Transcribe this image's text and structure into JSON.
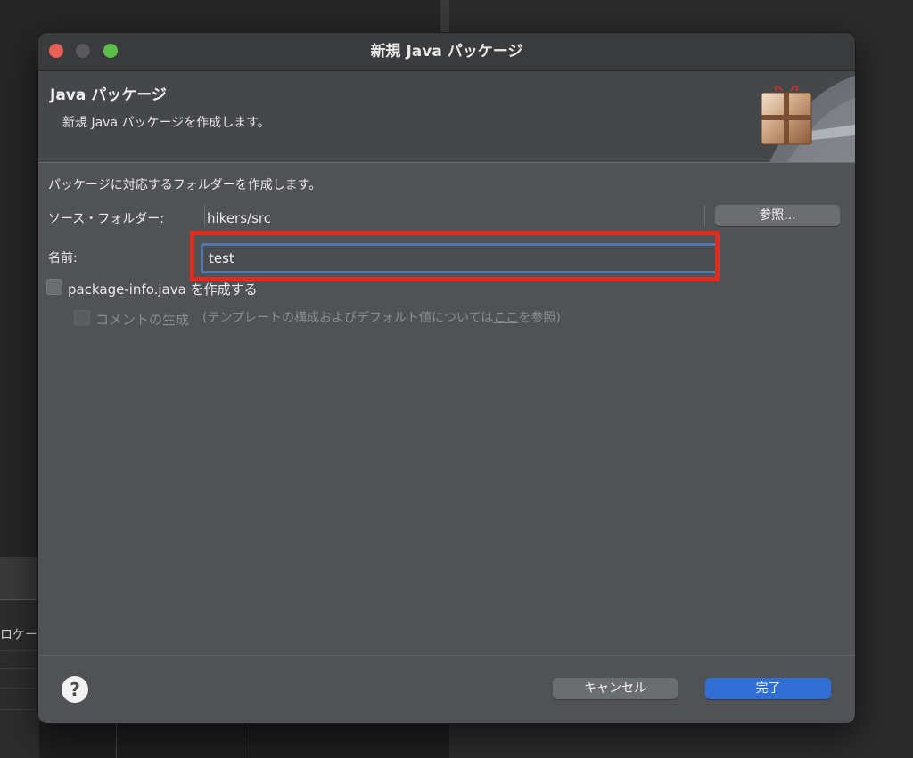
{
  "dialog": {
    "title": "新規 Java パッケージ",
    "header_title": "Java パッケージ",
    "header_description": "新規 Java パッケージを作成します。"
  },
  "form": {
    "info": "パッケージに対応するフォルダーを作成します。",
    "source_folder_label": "ソース・フォルダー:",
    "source_folder_value": "hikers/src",
    "browse_label": "参照...",
    "name_label": "名前:",
    "name_value": "test",
    "package_info_label": "package-info.java を作成する",
    "comment_label": "コメントの生成",
    "template_note_prefix": "(テンプレートの構成およびデフォルト値については",
    "template_note_link": "ここ",
    "template_note_suffix": "を参照)"
  },
  "footer": {
    "help_symbol": "?",
    "cancel_label": "キャンセル",
    "finish_label": "完了"
  },
  "background": {
    "left_panel_text": "ロケー"
  },
  "colors": {
    "highlight": "#e02b1f",
    "primary_button": "#2f6fd6",
    "input_focus": "#4e79a8"
  }
}
